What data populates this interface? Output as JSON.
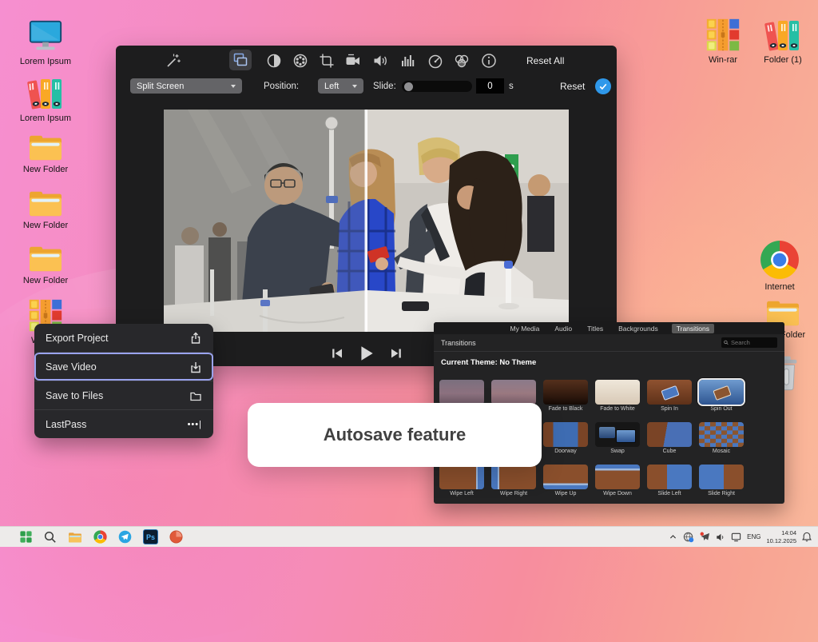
{
  "desktop": {
    "icons_left": [
      {
        "label": "Lorem Ipsum"
      },
      {
        "label": "Lorem Ipsum"
      },
      {
        "label": "New Folder"
      },
      {
        "label": "New Folder"
      },
      {
        "label": "New Folder"
      },
      {
        "label": "Win-rar"
      }
    ],
    "icons_top_right": [
      {
        "label": "Win-rar"
      },
      {
        "label": "Folder (1)"
      }
    ],
    "icons_right": [
      {
        "label": "Internet"
      },
      {
        "label": "New Folder"
      }
    ]
  },
  "editor": {
    "toolbar": {
      "reset_all_label": "Reset All"
    },
    "settings": {
      "effect_value": "Split Screen",
      "position_label": "Position:",
      "position_value": "Left",
      "slide_label": "Slide:",
      "duration_value": "0",
      "duration_unit": "s",
      "reset_label": "Reset"
    },
    "video": {
      "sign_text": "3"
    }
  },
  "context_menu": {
    "items": [
      {
        "label": "Export Project"
      },
      {
        "label": "Save Video"
      },
      {
        "label": "Save to Files"
      },
      {
        "label": "LastPass",
        "icon_text": "•••|"
      }
    ]
  },
  "panel": {
    "tabs": [
      {
        "label": "My Media"
      },
      {
        "label": "Audio"
      },
      {
        "label": "Titles"
      },
      {
        "label": "Backgrounds"
      },
      {
        "label": "Transitions"
      }
    ],
    "title": "Transitions",
    "search_placeholder": "Search",
    "current_theme": "Current Theme: No Theme",
    "transitions": [
      {
        "label": ""
      },
      {
        "label": ""
      },
      {
        "label": "Fade to Black"
      },
      {
        "label": "Fade to White"
      },
      {
        "label": "Spin In"
      },
      {
        "label": "Spin Out"
      },
      {
        "label": ""
      },
      {
        "label": ""
      },
      {
        "label": "Doorway"
      },
      {
        "label": "Swap"
      },
      {
        "label": "Cube"
      },
      {
        "label": "Mosaic"
      },
      {
        "label": "Wipe Left"
      },
      {
        "label": "Wipe Right"
      },
      {
        "label": "Wipe Up"
      },
      {
        "label": "Wipe Down"
      },
      {
        "label": "Slide Left"
      },
      {
        "label": "Slide Right"
      }
    ]
  },
  "tooltip": {
    "text": "Autosave feature"
  },
  "taskbar": {
    "ps_label": "Ps",
    "tray": {
      "language": "ENG",
      "time": "14:04",
      "date": "10.12.2025"
    }
  }
}
